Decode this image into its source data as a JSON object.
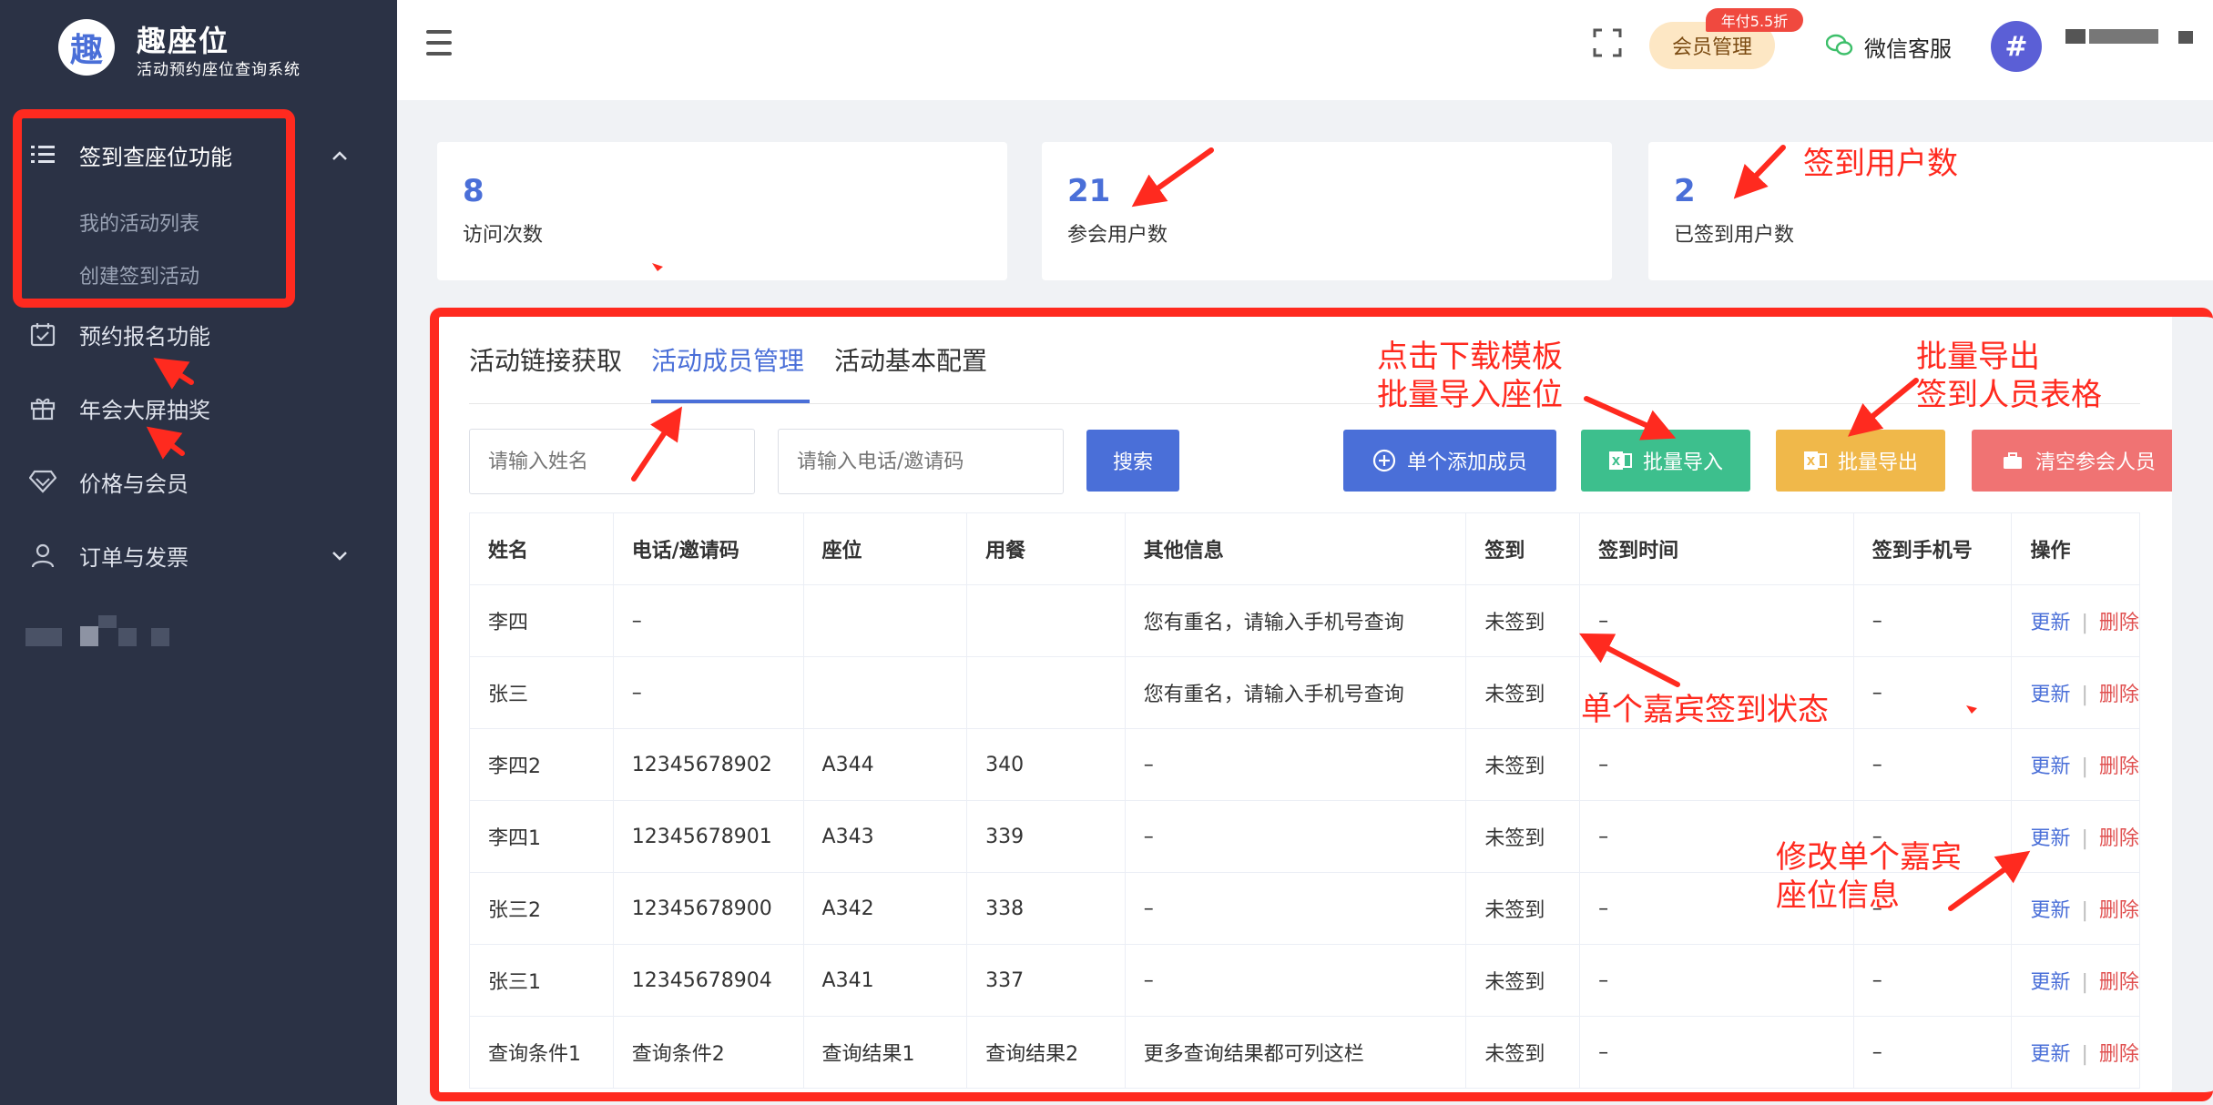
{
  "app": {
    "logo_char": "趣",
    "title": "趣座位",
    "subtitle": "活动预约座位查询系统"
  },
  "sidebar": {
    "items": [
      {
        "label": "签到查座位功能",
        "icon": "list-icon",
        "expanded": true
      },
      {
        "label": "预约报名功能",
        "icon": "calendar-check-icon"
      },
      {
        "label": "年会大屏抽奖",
        "icon": "gift-icon"
      },
      {
        "label": "价格与会员",
        "icon": "diamond-icon"
      },
      {
        "label": "订单与发票",
        "icon": "user-icon",
        "expandable": true
      }
    ],
    "sub_items": [
      "我的活动列表",
      "创建签到活动"
    ]
  },
  "header": {
    "member_label": "会员管理",
    "member_badge": "年付5.5折",
    "wechat_label": "微信客服",
    "avatar_char": "#"
  },
  "stats": [
    {
      "value": "8",
      "label": "访问次数"
    },
    {
      "value": "21",
      "label": "参会用户数"
    },
    {
      "value": "2",
      "label": "已签到用户数"
    }
  ],
  "tabs": [
    "活动链接获取",
    "活动成员管理",
    "活动基本配置"
  ],
  "active_tab": 1,
  "search": {
    "name_placeholder": "请输入姓名",
    "phone_placeholder": "请输入电话/邀请码",
    "search_label": "搜索"
  },
  "actions": {
    "add_single": "单个添加成员",
    "batch_import": "批量导入",
    "batch_export": "批量导出",
    "clear_members": "清空参会人员"
  },
  "colors": {
    "primary": "#4a6fd8",
    "success": "#3dbf8d",
    "warning": "#f0b84a",
    "danger": "#f07373",
    "annotation": "#ff2a1f",
    "sidebar_bg": "#2b3245"
  },
  "table": {
    "columns": [
      "姓名",
      "电话/邀请码",
      "座位",
      "用餐",
      "其他信息",
      "签到",
      "签到时间",
      "签到手机号",
      "操作"
    ],
    "rows": [
      [
        "李四",
        "–",
        "",
        "",
        "您有重名，请输入手机号查询",
        "未签到",
        "–",
        "–"
      ],
      [
        "张三",
        "–",
        "",
        "",
        "您有重名，请输入手机号查询",
        "未签到",
        "–",
        "–"
      ],
      [
        "李四2",
        "12345678902",
        "A344",
        "340",
        "–",
        "未签到",
        "–",
        "–"
      ],
      [
        "李四1",
        "12345678901",
        "A343",
        "339",
        "–",
        "未签到",
        "–",
        "–"
      ],
      [
        "张三2",
        "12345678900",
        "A342",
        "338",
        "–",
        "未签到",
        "–",
        "–"
      ],
      [
        "张三1",
        "12345678904",
        "A341",
        "337",
        "–",
        "未签到",
        "–",
        "–"
      ],
      [
        "查询条件1",
        "查询条件2",
        "查询结果1",
        "查询结果2",
        "更多查询结果都可列这栏",
        "未签到",
        "–",
        "–"
      ]
    ],
    "edit_label": "更新",
    "delete_label": "删除"
  },
  "annotations": {
    "signin_users": "签到用户数",
    "download_template_1": "点击下载模板",
    "download_template_2": "批量导入座位",
    "export_1": "批量导出",
    "export_2": "签到人员表格",
    "guest_status": "单个嘉宾签到状态",
    "edit_seat_1": "修改单个嘉宾",
    "edit_seat_2": "座位信息"
  }
}
